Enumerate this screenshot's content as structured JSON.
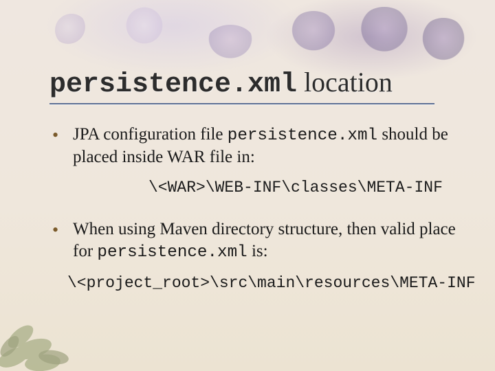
{
  "title": {
    "mono": "persistence.xml",
    "rest": " location"
  },
  "bullets": [
    {
      "pre": "JPA configuration file ",
      "mono": "persistence.xml",
      "post": " should be placed inside WAR file in:",
      "code": "\\<WAR>\\WEB-INF\\classes\\META-INF",
      "code_class": "indent"
    },
    {
      "pre": "When using Maven directory structure, then valid place for ",
      "mono": "persistence.xml",
      "post": " is:",
      "code": "\\<project_root>\\src\\main\\resources\\META-INF",
      "code_class": "full"
    }
  ]
}
